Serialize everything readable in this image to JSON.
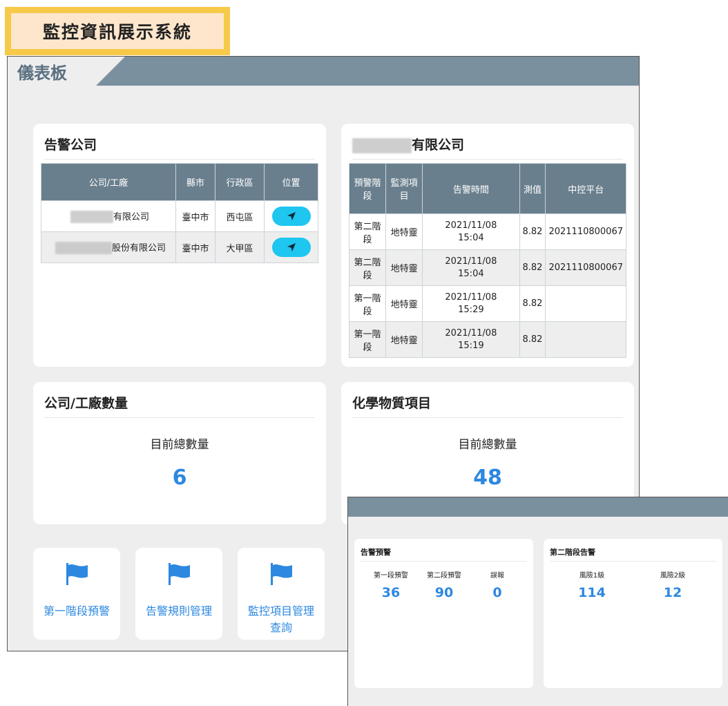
{
  "app_title": "監控資訊展示系統",
  "dashboard": {
    "title": "儀表板",
    "alert_companies": {
      "title": "告警公司",
      "columns": [
        "公司/工廠",
        "縣市",
        "行政區",
        "位置"
      ],
      "rows": [
        {
          "company_suffix": "有限公司",
          "city": "臺中市",
          "district": "西屯區"
        },
        {
          "company_suffix": "股份有限公司",
          "city": "臺中市",
          "district": "大甲區"
        }
      ],
      "location_icon": "navigation-arrow-icon"
    },
    "company_alerts": {
      "title_suffix": "有限公司",
      "columns": [
        "預警階段",
        "監測項目",
        "告警時間",
        "測值",
        "中控平台"
      ],
      "rows": [
        {
          "stage": "第二階段",
          "item": "地特靈",
          "date": "2021/11/08",
          "time": "15:04",
          "value": "8.82",
          "platform": "2021110800067"
        },
        {
          "stage": "第二階段",
          "item": "地特靈",
          "date": "2021/11/08",
          "time": "15:04",
          "value": "8.82",
          "platform": "2021110800067"
        },
        {
          "stage": "第一階段",
          "item": "地特靈",
          "date": "2021/11/08",
          "time": "15:29",
          "value": "8.82",
          "platform": ""
        },
        {
          "stage": "第一階段",
          "item": "地特靈",
          "date": "2021/11/08",
          "time": "15:19",
          "value": "8.82",
          "platform": ""
        }
      ]
    },
    "company_count": {
      "title": "公司/工廠數量",
      "label": "目前總數量",
      "value": "6"
    },
    "chemical_items": {
      "title": "化學物質項目",
      "label": "目前總數量",
      "value": "48"
    },
    "tiles": [
      {
        "label": "第一階段預警",
        "icon": "flag-icon"
      },
      {
        "label": "告警規則管理",
        "icon": "flag-icon"
      },
      {
        "label": "監控項目管理查詢",
        "icon": "flag-icon"
      }
    ]
  },
  "overlay": {
    "alerts": {
      "title": "告警預警",
      "stats": [
        {
          "label": "第一段預警",
          "value": "36"
        },
        {
          "label": "第二段預警",
          "value": "90"
        },
        {
          "label": "誤報",
          "value": "0"
        }
      ]
    },
    "stage2": {
      "title": "第二階段告警",
      "stats": [
        {
          "label": "風險1級",
          "value": "114"
        },
        {
          "label": "風險2級",
          "value": "12"
        }
      ]
    }
  },
  "colors": {
    "accent": "#2d88e0",
    "header": "#7b909f",
    "table_header": "#6a7f8d",
    "location_button": "#1ec6f0",
    "badge_outer": "#f7c948",
    "badge_inner": "#fde6cc"
  }
}
